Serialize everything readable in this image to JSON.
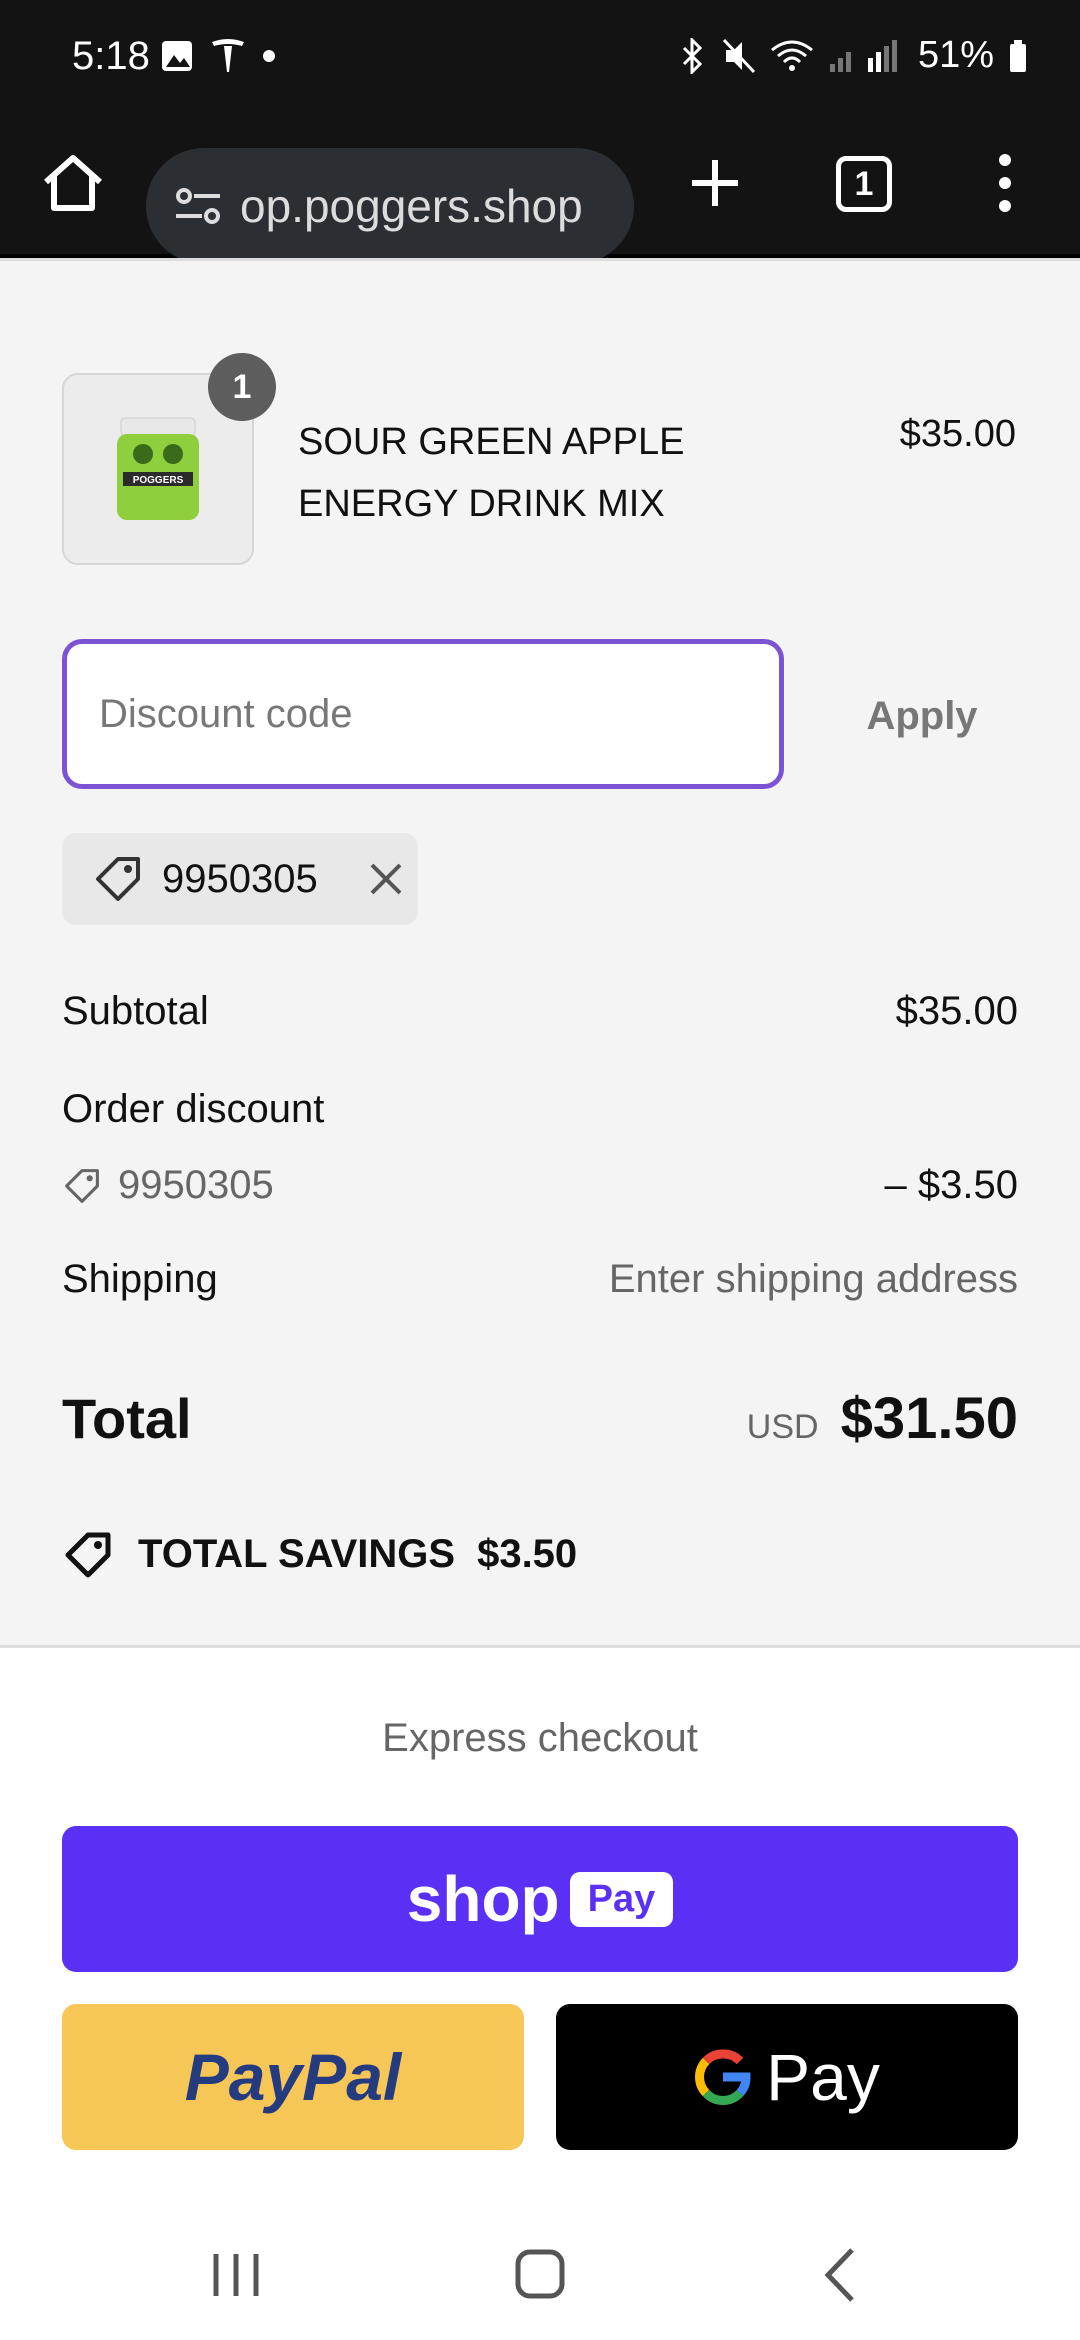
{
  "status_bar": {
    "time": "5:18",
    "battery": "51%"
  },
  "browser": {
    "url": "op.poggers.shop",
    "tab_count": "1"
  },
  "cart": {
    "quantity": "1",
    "product_name": "SOUR GREEN APPLE ENERGY DRINK MIX",
    "product_price": "$35.00",
    "product_image_text": "POGGERS"
  },
  "discount": {
    "placeholder": "Discount code",
    "apply_label": "Apply",
    "applied_code": "9950305"
  },
  "summary": {
    "subtotal_label": "Subtotal",
    "subtotal_value": "$35.00",
    "order_discount_label": "Order discount",
    "order_discount_code": "9950305",
    "order_discount_value": "– $3.50",
    "shipping_label": "Shipping",
    "shipping_value": "Enter shipping address",
    "total_label": "Total",
    "currency": "USD",
    "total_value": "$31.50",
    "savings_label": "TOTAL SAVINGS",
    "savings_value": "$3.50"
  },
  "checkout": {
    "express_label": "Express checkout",
    "shoppay_text": "shop",
    "shoppay_badge": "Pay",
    "paypal_label": "PayPal",
    "gpay_label": "Pay"
  },
  "colors": {
    "shoppay": "#5a31f4",
    "paypal": "#f6c657",
    "focus": "#7d53d5"
  }
}
